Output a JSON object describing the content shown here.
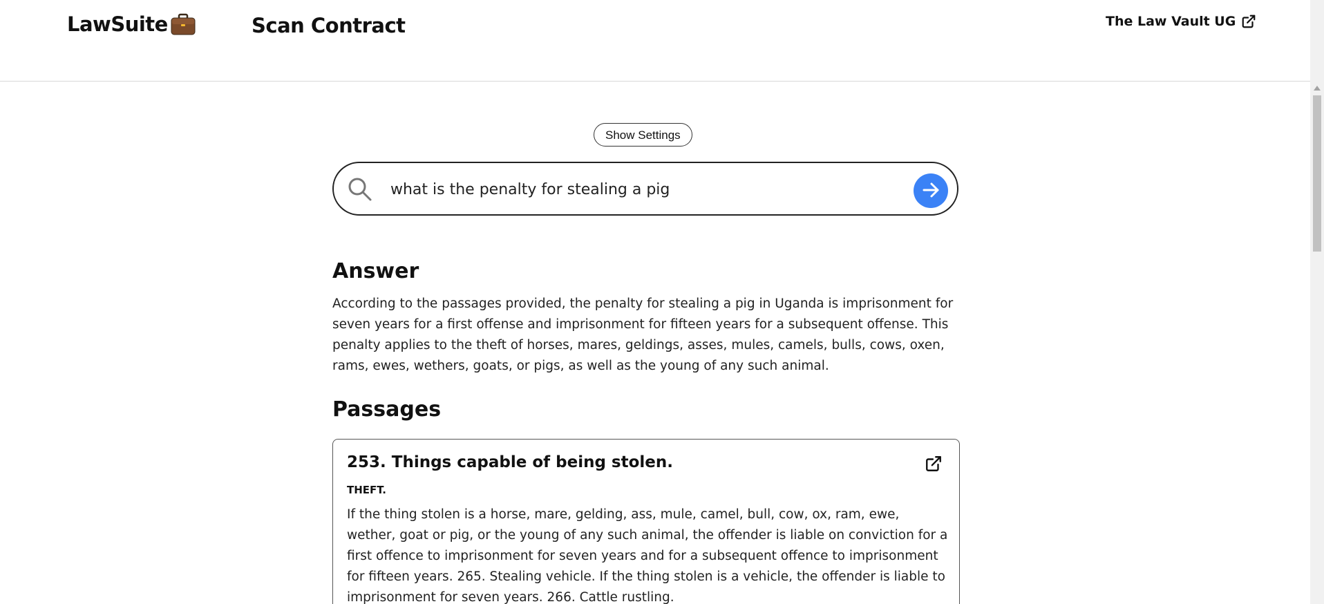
{
  "header": {
    "brand": "LawSuite",
    "brand_icon": "briefcase-icon",
    "nav_scan": "Scan Contract",
    "vault_link": "The Law Vault UG",
    "vault_icon": "external-link-icon"
  },
  "settings": {
    "button_label": "Show Settings"
  },
  "search": {
    "value": "what is the penalty for stealing a pig",
    "icon": "search-icon",
    "submit_icon": "arrow-right-icon",
    "submit_color": "#3b82f6"
  },
  "answer": {
    "heading": "Answer",
    "text": "According to the passages provided, the penalty for stealing a pig in Uganda is imprisonment for seven years for a first offense and imprisonment for fifteen years for a subsequent offense. This penalty applies to the theft of horses, mares, geldings, asses, mules, camels, bulls, cows, oxen, rams, ewes, wethers, goats, or pigs, as well as the young of any such animal."
  },
  "passages": {
    "heading": "Passages",
    "items": [
      {
        "title": "253. Things capable of being stolen.",
        "section": "THEFT.",
        "text": "If the thing stolen is a horse, mare, gelding, ass, mule, camel, bull, cow, ox, ram, ewe, wether, goat or pig, or the young of any such animal, the offender is liable on conviction for a first offence to imprisonment for seven years and for a subsequent offence to imprisonment for fifteen years. 265. Stealing vehicle. If the thing stolen is a vehicle, the offender is liable to imprisonment for seven years. 266. Cattle rustling.",
        "icon": "external-link-icon"
      }
    ]
  }
}
